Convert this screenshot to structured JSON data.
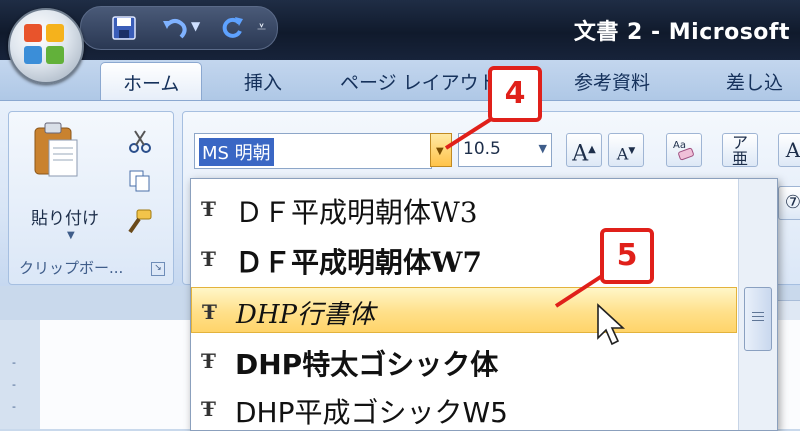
{
  "titlebar": {
    "title": "文書 2 - Microsoft"
  },
  "tabs": [
    "ホーム",
    "挿入",
    "ページ レイアウト",
    "参考資料",
    "差し込"
  ],
  "ribbon": {
    "clipboard": {
      "paste_label": "貼り付け",
      "group_label": "クリップボー..."
    },
    "font": {
      "font_name": "MS 明朝",
      "font_size": "10.5"
    }
  },
  "font_list": [
    {
      "name": "ＤＦ平成明朝体W3",
      "highlighted": false
    },
    {
      "name": "ＤＦ平成明朝体W7",
      "highlighted": false
    },
    {
      "name": "DHP行書体",
      "highlighted": true
    },
    {
      "name": "DHP特太ゴシック体",
      "highlighted": false
    },
    {
      "name": "DHP平成ゴシックW5",
      "highlighted": false
    }
  ],
  "callouts": {
    "step4": "4",
    "step5": "5"
  },
  "colors": {
    "callout": "#e0201a",
    "highlight": "#ffd46a",
    "selection": "#3a67c4"
  }
}
